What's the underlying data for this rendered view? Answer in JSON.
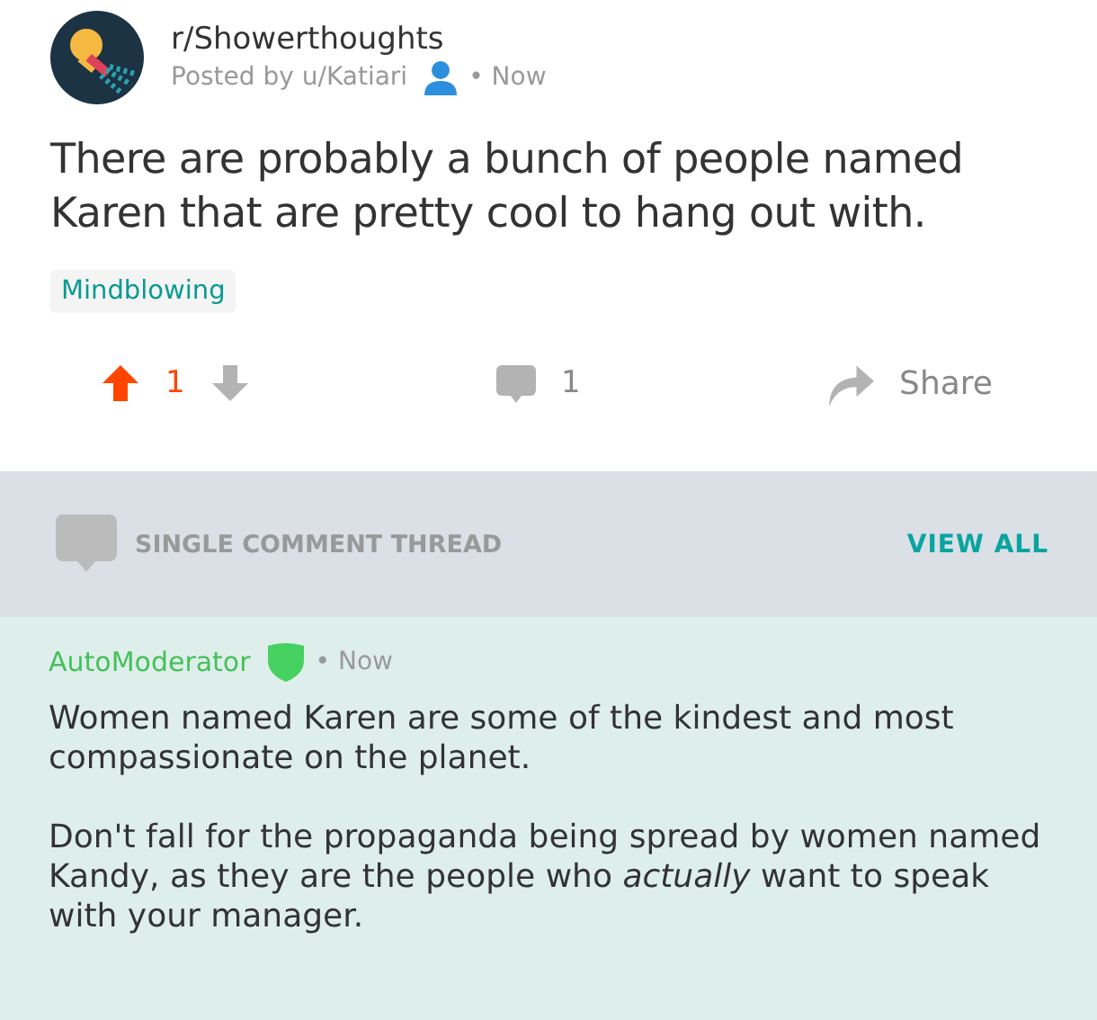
{
  "post": {
    "subreddit": "r/Showerthoughts",
    "posted_by": "Posted by u/Katiari",
    "time": "• Now",
    "title": "There are probably a bunch of people named Karen that are pretty cool to hang out with.",
    "flair": "Mindblowing"
  },
  "actions": {
    "upvoted": true,
    "score": "1",
    "comments": "1",
    "share": "Share"
  },
  "thread_bar": {
    "label": "SINGLE COMMENT THREAD",
    "link": "VIEW ALL"
  },
  "comment": {
    "author": "AutoModerator",
    "moderator": true,
    "time": "• Now",
    "paragraphs": [
      "Women named Karen are some of the kindest and most compassionate on the planet.",
      "Don't fall for the propaganda being spread by women named Kandy, as they are the people who *actually* want to speak with your manager."
    ]
  }
}
